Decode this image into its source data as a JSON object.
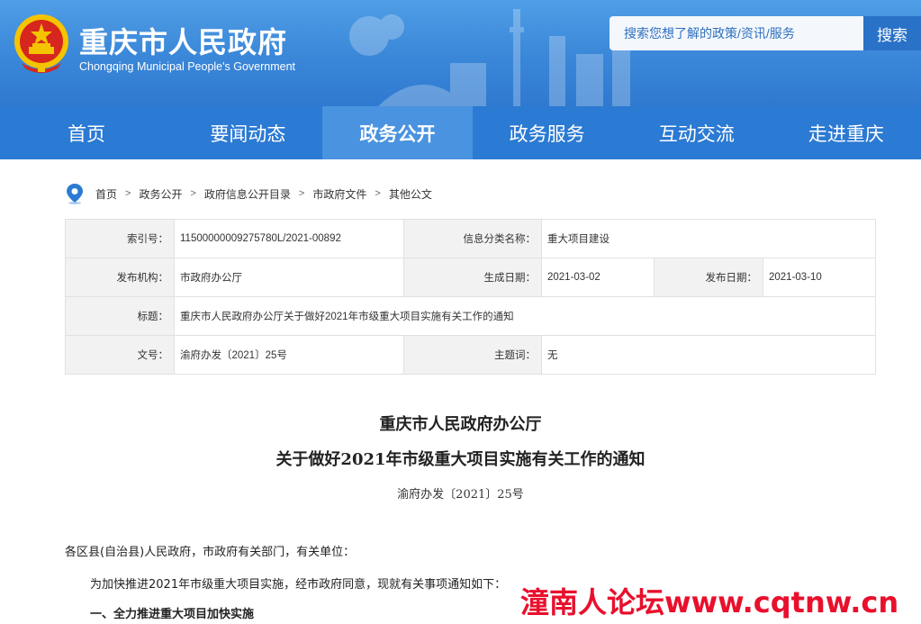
{
  "header": {
    "title": "重庆市人民政府",
    "subtitle": "Chongqing Municipal People's Government",
    "search_placeholder": "搜索您想了解的政策/资讯/服务",
    "search_button": "搜索"
  },
  "nav": {
    "items": [
      "首页",
      "要闻动态",
      "政务公开",
      "政务服务",
      "互动交流",
      "走进重庆"
    ],
    "active_index": 2
  },
  "breadcrumb": [
    "首页",
    "政务公开",
    "政府信息公开目录",
    "市政府文件",
    "其他公文"
  ],
  "breadcrumb_sep": ">",
  "info": {
    "index_label": "索引号：",
    "index_value": "11500000009275780L/2021-00892",
    "category_label": "信息分类名称：",
    "category_value": "重大项目建设",
    "publisher_label": "发布机构：",
    "publisher_value": "市政府办公厅",
    "created_label": "生成日期：",
    "created_value": "2021-03-02",
    "published_label": "发布日期：",
    "published_value": "2021-03-10",
    "title_label": "标题：",
    "title_value": "重庆市人民政府办公厅关于做好2021年市级重大项目实施有关工作的通知",
    "docno_label": "文号：",
    "docno_value": "渝府办发〔2021〕25号",
    "topic_label": "主题词：",
    "topic_value": "无"
  },
  "document": {
    "title_line1": "重庆市人民政府办公厅",
    "title_line2": "关于做好2021年市级重大项目实施有关工作的通知",
    "number": "渝府办发〔2021〕25号",
    "recipients": "各区县(自治县)人民政府，市政府有关部门，有关单位：",
    "intro": "为加快推进2021年市级重大项目实施，经市政府同意，现就有关事项通知如下：",
    "section1": "一、全力推进重大项目加快实施"
  },
  "watermark": "潼南人论坛www.cqtnw.cn",
  "colors": {
    "header_blue": "#3a86d8",
    "nav_blue": "#2b7ad3",
    "nav_active": "#4a93e0",
    "watermark_red": "#e8102d"
  }
}
